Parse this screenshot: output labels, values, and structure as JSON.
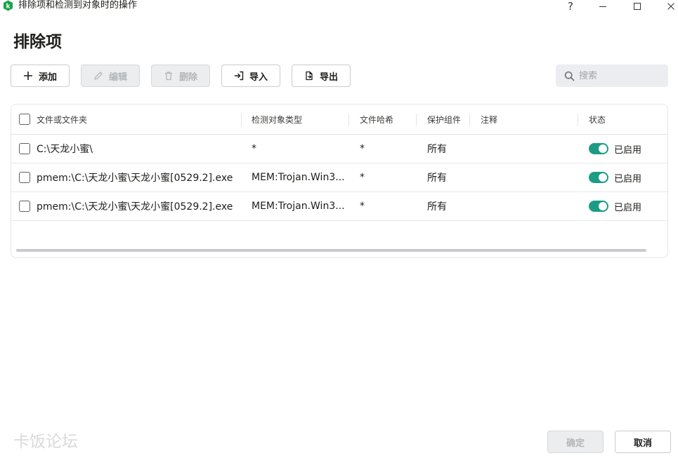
{
  "window": {
    "title": "排除项和检测到对象时的操作",
    "help_label": "?"
  },
  "page": {
    "title": "排除项"
  },
  "toolbar": {
    "add_label": "添加",
    "edit_label": "编辑",
    "delete_label": "删除",
    "import_label": "导入",
    "export_label": "导出"
  },
  "search": {
    "placeholder": "搜索",
    "value": ""
  },
  "table": {
    "columns": [
      "文件或文件夹",
      "检测对象类型",
      "文件哈希",
      "保护组件",
      "注释",
      "状态"
    ],
    "rows": [
      {
        "path": "C:\\天龙小蜜\\",
        "object_type": "*",
        "hash": "*",
        "component": "所有",
        "comment": "",
        "status": "已启用",
        "enabled": true
      },
      {
        "path": "pmem:\\C:\\天龙小蜜\\天龙小蜜[0529.2].exe",
        "object_type": "MEM:Trojan.Win3...",
        "hash": "*",
        "component": "所有",
        "comment": "",
        "status": "已启用",
        "enabled": true
      },
      {
        "path": "pmem:\\C:\\天龙小蜜\\天龙小蜜[0529.2].exe",
        "object_type": "MEM:Trojan.Win3...",
        "hash": "*",
        "component": "所有",
        "comment": "",
        "status": "已启用",
        "enabled": true
      }
    ]
  },
  "footer": {
    "watermark": "卡饭论坛",
    "ok_label": "确定",
    "cancel_label": "取消"
  },
  "colors": {
    "toggle_on": "#1b9c85",
    "app_icon": "#1aa34a"
  }
}
